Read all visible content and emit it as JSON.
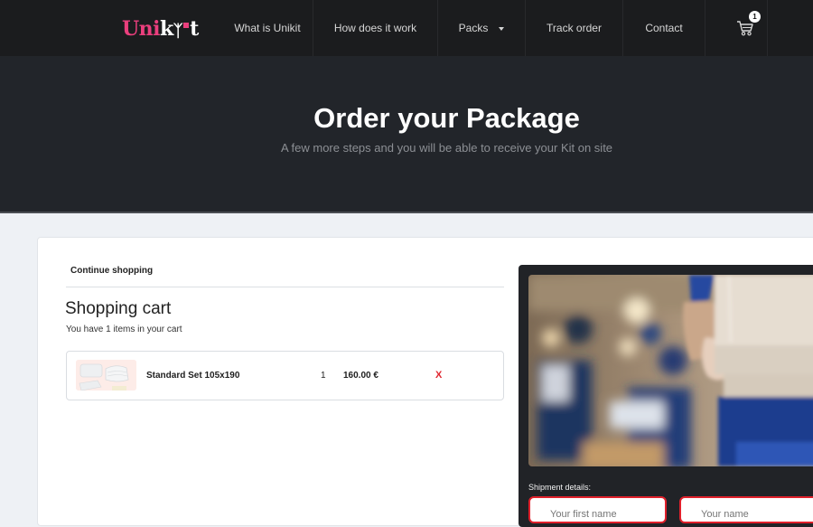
{
  "brand": {
    "logo_part1": "Uni",
    "logo_part2": "k",
    "logo_part3": "t",
    "primary_color": "#ea3f7d",
    "danger_color": "#e0262f"
  },
  "nav": {
    "items": [
      {
        "label": "What is Unikit"
      },
      {
        "label": "How does it work"
      },
      {
        "label": "Packs",
        "has_dropdown": true
      },
      {
        "label": "Track order"
      },
      {
        "label": "Contact"
      }
    ],
    "cart_icon": "shopping-cart-icon",
    "cart_badge": "1"
  },
  "hero": {
    "title": "Order your Package",
    "subtitle": "A few more steps and you will be able to receive your Kit on site"
  },
  "cart": {
    "continue_label": "Continue shopping",
    "title": "Shopping cart",
    "count_text": "You have 1 items in your cart",
    "items": [
      {
        "name": "Standard Set 105x190",
        "quantity": "1",
        "price": "160.00 €",
        "remove_label": "X",
        "thumbnail": "bedding-set-image"
      }
    ]
  },
  "shipment": {
    "photo": "delivery-worker-holding-box-image",
    "label": "Shipment details:",
    "fields": [
      {
        "placeholder": "Your first name"
      },
      {
        "placeholder": "Your name"
      }
    ]
  }
}
